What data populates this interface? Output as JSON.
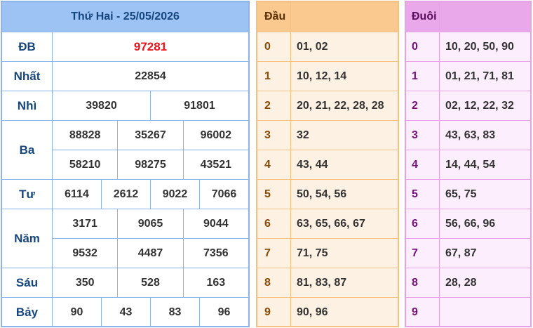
{
  "results": {
    "title": "Thứ Hai - 25/05/2026",
    "prizes": {
      "db": {
        "label": "ĐB",
        "values": [
          "97281"
        ]
      },
      "nhat": {
        "label": "Nhất",
        "values": [
          "22854"
        ]
      },
      "nhi": {
        "label": "Nhì",
        "values": [
          "39820",
          "91801"
        ]
      },
      "ba": {
        "label": "Ba",
        "values": [
          "88828",
          "35267",
          "96002",
          "58210",
          "98275",
          "43521"
        ]
      },
      "tu": {
        "label": "Tư",
        "values": [
          "6114",
          "2612",
          "9022",
          "7066"
        ]
      },
      "nam": {
        "label": "Năm",
        "values": [
          "3171",
          "9065",
          "9044",
          "9532",
          "4487",
          "7356"
        ]
      },
      "sau": {
        "label": "Sáu",
        "values": [
          "350",
          "528",
          "163"
        ]
      },
      "bay": {
        "label": "Bảy",
        "values": [
          "90",
          "43",
          "83",
          "96"
        ]
      }
    }
  },
  "dau": {
    "header": "Đầu",
    "rows": [
      {
        "key": "0",
        "values": "01, 02"
      },
      {
        "key": "1",
        "values": "10, 12, 14"
      },
      {
        "key": "2",
        "values": "20, 21, 22, 28, 28"
      },
      {
        "key": "3",
        "values": "32"
      },
      {
        "key": "4",
        "values": "43, 44"
      },
      {
        "key": "5",
        "values": "50, 54, 56"
      },
      {
        "key": "6",
        "values": "63, 65, 66, 67"
      },
      {
        "key": "7",
        "values": "71, 75"
      },
      {
        "key": "8",
        "values": "81, 83, 87"
      },
      {
        "key": "9",
        "values": "90, 96"
      }
    ]
  },
  "duoi": {
    "header": "Đuôi",
    "rows": [
      {
        "key": "0",
        "values": "10, 20, 50, 90"
      },
      {
        "key": "1",
        "values": "01, 21, 71, 81"
      },
      {
        "key": "2",
        "values": "02, 12, 22, 32"
      },
      {
        "key": "3",
        "values": "43, 63, 83"
      },
      {
        "key": "4",
        "values": "14, 44, 54"
      },
      {
        "key": "5",
        "values": "65, 75"
      },
      {
        "key": "6",
        "values": "56, 66, 96"
      },
      {
        "key": "7",
        "values": "67, 87"
      },
      {
        "key": "8",
        "values": "28, 28"
      },
      {
        "key": "9",
        "values": ""
      }
    ]
  },
  "colors": {
    "special_prize": "#e8141a",
    "results_header": "#9dc3f5",
    "dau_header": "#f9c98f",
    "duoi_header": "#e8a8ea"
  }
}
